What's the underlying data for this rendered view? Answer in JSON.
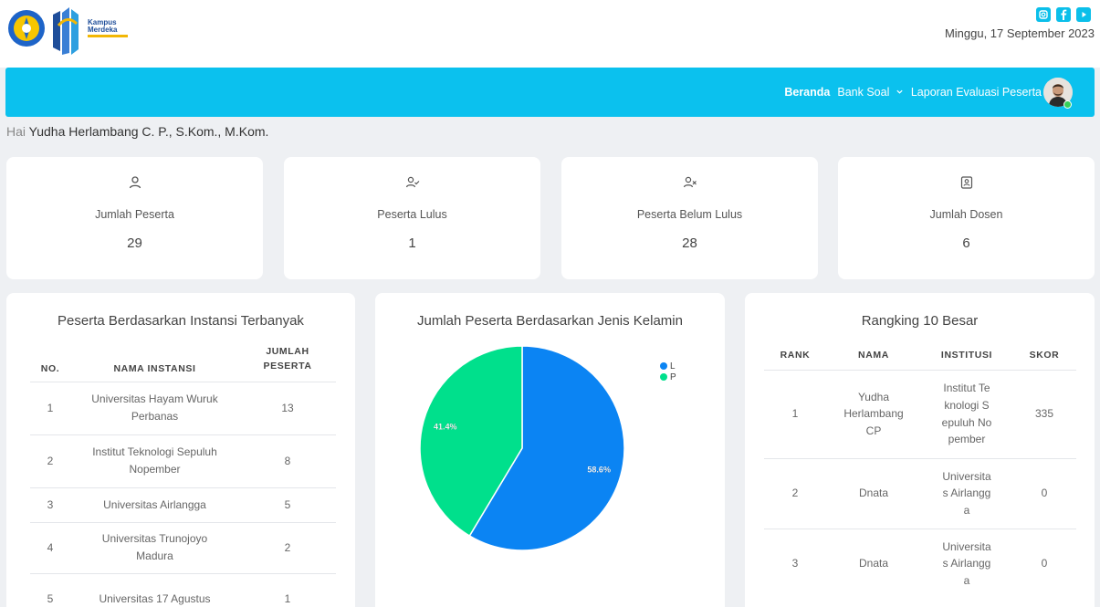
{
  "header": {
    "date": "Minggu, 17 September 2023",
    "logo_text_line1": "Kampus",
    "logo_text_line2": "Merdeka",
    "social_icons": [
      "instagram-icon",
      "facebook-icon",
      "youtube-icon"
    ]
  },
  "nav": {
    "items": [
      {
        "label": "Beranda",
        "active": true
      },
      {
        "label": "Bank Soal",
        "dropdown": true
      },
      {
        "label": "Laporan Evaluasi Peserta"
      }
    ]
  },
  "greeting": {
    "prefix": "Hai",
    "name": "Yudha Herlambang C. P., S.Kom., M.Kom."
  },
  "stats": [
    {
      "label": "Jumlah Peserta",
      "value": "29",
      "icon": "user-icon"
    },
    {
      "label": "Peserta Lulus",
      "value": "1",
      "icon": "user-check-icon"
    },
    {
      "label": "Peserta Belum Lulus",
      "value": "28",
      "icon": "user-x-icon"
    },
    {
      "label": "Jumlah Dosen",
      "value": "6",
      "icon": "id-card-icon"
    }
  ],
  "instansi": {
    "title": "Peserta Berdasarkan Instansi Terbanyak",
    "headers": [
      "NO.",
      "NAMA INSTANSI",
      "JUMLAH PESERTA"
    ],
    "rows": [
      [
        "1",
        "Universitas Hayam Wuruk Perbanas",
        "13"
      ],
      [
        "2",
        "Institut Teknologi Sepuluh Nopember",
        "8"
      ],
      [
        "3",
        "Universitas Airlangga",
        "5"
      ],
      [
        "4",
        "Universitas Trunojoyo Madura",
        "2"
      ],
      [
        "5",
        "Universitas 17 Agustus",
        "1"
      ]
    ]
  },
  "gender_chart": {
    "title": "Jumlah Peserta Berdasarkan Jenis Kelamin",
    "legend": [
      "L",
      "P"
    ],
    "colors": [
      "#0b84f3",
      "#00e08c"
    ]
  },
  "chart_data": {
    "type": "pie",
    "title": "Jumlah Peserta Berdasarkan Jenis Kelamin",
    "categories": [
      "L",
      "P"
    ],
    "values": [
      58.6,
      41.4
    ],
    "labels": [
      "58.6%",
      "41.4%"
    ],
    "legend_position": "top-right"
  },
  "ranking": {
    "title": "Rangking 10 Besar",
    "headers": [
      "RANK",
      "NAMA",
      "INSTITUSI",
      "SKOR"
    ],
    "rows": [
      [
        "1",
        "Yudha Herlambang CP",
        "Institut Teknologi Sepuluh Nopember",
        "335"
      ],
      [
        "2",
        "Dnata",
        "Universitas Airlangga",
        "0"
      ],
      [
        "3",
        "Dnata",
        "Universitas Airlangga",
        "0"
      ]
    ]
  }
}
